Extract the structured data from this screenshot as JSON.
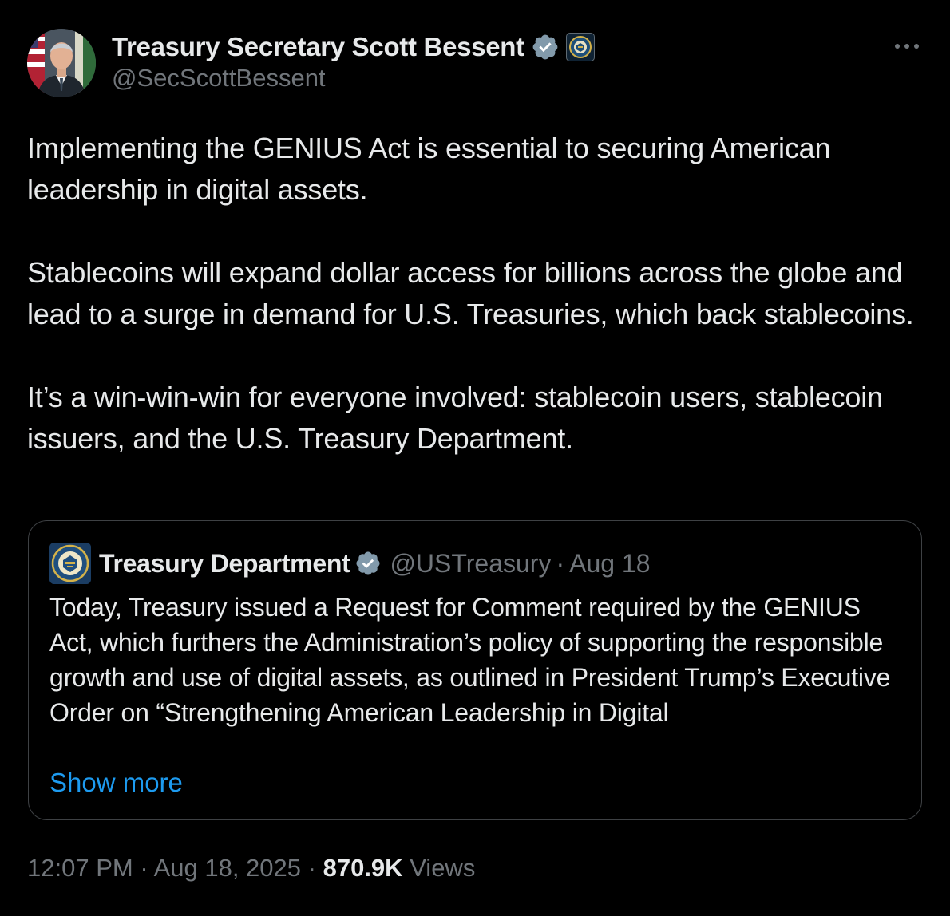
{
  "author": {
    "display_name": "Treasury Secretary Scott Bessent",
    "handle": "@SecScottBessent",
    "verified_icon": "verified-badge-icon",
    "affiliation_icon": "treasury-seal-icon",
    "verified_color": "#829aab"
  },
  "menu": {
    "icon": "more-options-icon"
  },
  "tweet": {
    "paragraphs": [
      "Implementing the GENIUS Act is essential to securing American leadership in digital assets.",
      "Stablecoins will expand dollar access for billions across the globe and lead to a surge in demand for U.S. Treasuries, which back stablecoins.",
      "It’s a win-win-win for everyone involved: stablecoin users, stablecoin issuers, and the U.S. Treasury Department."
    ]
  },
  "quoted_tweet": {
    "display_name": "Treasury Department",
    "handle": "@USTreasury",
    "separator": "·",
    "date": "Aug 18",
    "text": "Today, Treasury issued a Request for Comment required by the GENIUS Act, which furthers the Administration’s policy of supporting the responsible growth and use of digital assets, as outlined in President Trump’s Executive Order on “Strengthening American Leadership in Digital",
    "show_more": "Show more"
  },
  "meta": {
    "time": "12:07 PM",
    "separator": "·",
    "date": "Aug 18, 2025",
    "views_count": "870.9K",
    "views_label": "Views"
  },
  "colors": {
    "background": "#000000",
    "text_primary": "#e7e9ea",
    "text_secondary": "#71767b",
    "link": "#1d9bf0",
    "border": "#3e4144"
  }
}
